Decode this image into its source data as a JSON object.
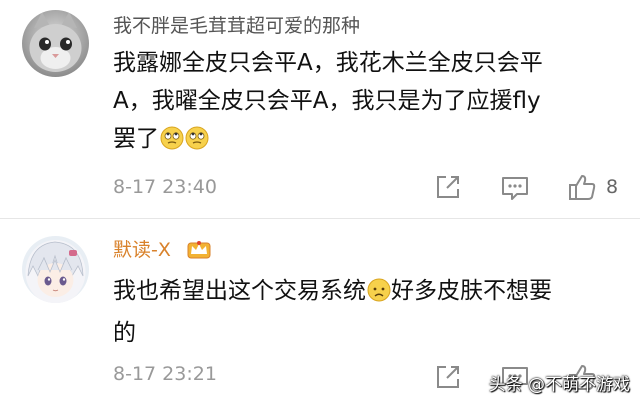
{
  "comments": [
    {
      "username": "我不胖是毛茸茸超可爱的那种",
      "avatar_icon": "kitten-avatar",
      "text_lines": [
        "我露娜全皮只会平A，我花木兰全皮只会平",
        "A，我曜全皮只会平A，我只是为了应援fly",
        "罢了"
      ],
      "emojis": [
        "rolling-eyes-emoji",
        "rolling-eyes-emoji"
      ],
      "timestamp": "8-17 23:40",
      "like_count": "8"
    },
    {
      "username": "默读-X",
      "name_color": "#d9822b",
      "badge_icon": "crown-icon",
      "avatar_icon": "anime-girl-avatar",
      "text_lines": [
        "我也希望出这个交易系统",
        "好多皮肤不想要",
        "的"
      ],
      "emojis": [
        "sad-face-emoji"
      ],
      "timestamp": "8-17 23:21",
      "like_count": ""
    }
  ],
  "watermark": "头条 @不萌不游戏",
  "colors": {
    "username_gray": "#555555",
    "vip_orange": "#d9822b",
    "meta_gray": "#999999",
    "icon_gray": "#8a8a8a"
  }
}
